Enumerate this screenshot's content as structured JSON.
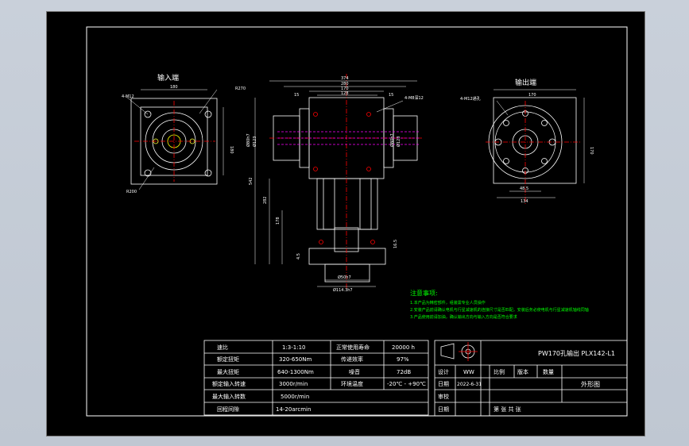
{
  "views": {
    "input_title": "输入端",
    "output_title": "输出端"
  },
  "dims": {
    "in_hole": "4-M12",
    "in_top": "180",
    "in_side": "180",
    "in_circle_top": "R270",
    "in_circle_bot": "R200",
    "fr_374": "374",
    "fr_280": "280",
    "fr_170": "170",
    "fr_128": "128",
    "fr_15a": "15",
    "fr_15b": "15",
    "fr_hole": "4-M8深12",
    "fr_left1": "Ø80h7",
    "fr_left2": "Ø123",
    "fr_right1": "Ø80h7",
    "fr_right2": "Ø123",
    "fr_542": "542",
    "fr_282": "282",
    "fr_178": "178",
    "fr_bot1": "Ø50h7",
    "fr_bot2": "Ø114.3h7",
    "fr_s1": "4.5",
    "fr_s2": "16.5",
    "out_hole": "4-M12通孔",
    "out_top": "170",
    "out_side": "170",
    "out_b1": "48.5",
    "out_b2": "134"
  },
  "notes": {
    "title": "注意事项:",
    "items": [
      "1.本产品为精密部件，组装需专业人员操作",
      "2.安装产品前请确认电机与行星减速机的连接尺寸是否匹配，安装后务必使电机与行星减速机轴线同轴",
      "3.产品使用前请加油，确认输出方向与输入方向是否符合要求"
    ]
  },
  "spec_table": [
    [
      "速比",
      "1:3-1:10",
      "正常使用寿命",
      "20000 h"
    ],
    [
      "额定扭矩",
      "320-650Nm",
      "传递效率",
      "97%"
    ],
    [
      "最大扭矩",
      "640-1300Nm",
      "噪音",
      "72dB"
    ],
    [
      "额定输入转速",
      "3000r/min",
      "环境温度",
      "-20℃ - +90℃"
    ],
    [
      "最大输入转数",
      "5000r/min",
      "",
      ""
    ],
    [
      "回程间隙",
      "14-20arcmin",
      "",
      ""
    ]
  ],
  "title_block": {
    "drawing_name": "PW170孔输出 PLX142-L1",
    "view_name": "外形图",
    "design_label": "设计",
    "designer": "WW",
    "scale_label": "比例",
    "version_label": "版本",
    "qty_label": "数量",
    "date_label1": "日期",
    "date_value": "2022-6-31",
    "review_label": "审校",
    "date_label2": "日期",
    "page_text": "第    张    共    张"
  },
  "colors": {
    "background": "#c5ccd6",
    "sheet": "#000000",
    "line": "#ffffff",
    "center": "#ff0000",
    "notes": "#00ff00",
    "accent": "#00aaff",
    "hidden": "#ff00ff"
  }
}
